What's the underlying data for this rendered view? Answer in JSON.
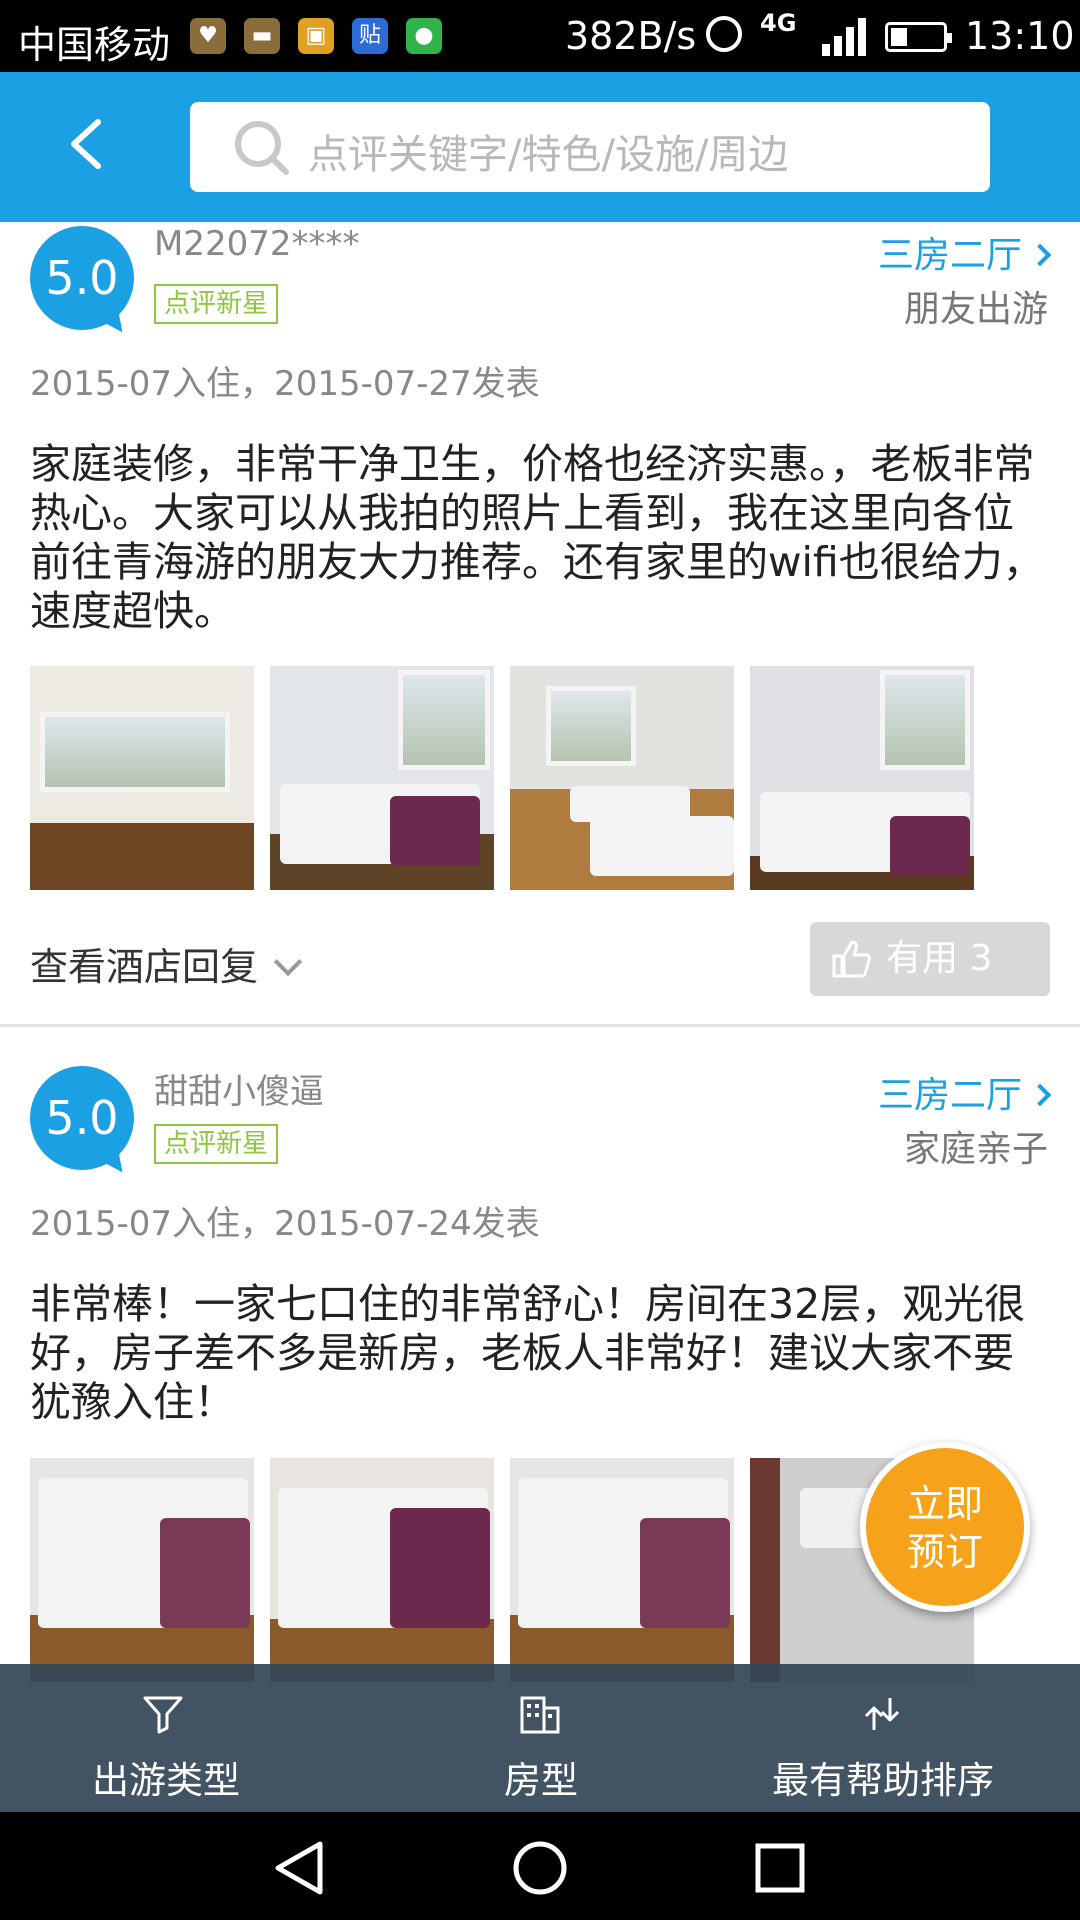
{
  "status_bar": {
    "carrier": "中国移动",
    "apps": [
      {
        "icon": "activity-app-icon",
        "color": "#8a6d3b",
        "glyph": "♥"
      },
      {
        "icon": "chat-app-icon",
        "color": "#8a6d3b",
        "glyph": "▬"
      },
      {
        "icon": "bag-app-icon",
        "color": "#e0a020",
        "glyph": "▣"
      },
      {
        "icon": "tieba-app-icon",
        "color": "#2d6bd6",
        "glyph": "贴"
      },
      {
        "icon": "wechat-app-icon",
        "color": "#2fb34a",
        "glyph": "●"
      }
    ],
    "speed": "382B/s",
    "network": "4G",
    "time": "13:10"
  },
  "header": {
    "back_icon": "chevron-left-icon",
    "search_placeholder": "点评关键字/特色/设施/周边"
  },
  "reviews": [
    {
      "score": "5.0",
      "username": "M22072****",
      "badge": "点评新星",
      "room_type": "三房二厅",
      "trip_type": "朋友出游",
      "dates": "2015-07入住，2015-07-27发表",
      "content": "家庭装修，非常干净卫生，价格也经济实惠。，老板非常热心。大家可以从我拍的照片上看到，我在这里向各位前往青海游的朋友大力推荐。还有家里的wifi也很给力，速度超快。",
      "hotel_reply": "查看酒店回复",
      "useful": "有用 3"
    },
    {
      "score": "5.0",
      "username": "甜甜小傻逼",
      "badge": "点评新星",
      "room_type": "三房二厅",
      "trip_type": "家庭亲子",
      "dates": "2015-07入住，2015-07-24发表",
      "content": "非常棒！一家七口住的非常舒心！房间在32层，观光很好，房子差不多是新房，老板人非常好！建议大家不要犹豫入住！"
    }
  ],
  "book_button": {
    "line1": "立即",
    "line2": "预订"
  },
  "filter_bar": {
    "items": [
      {
        "label": "出游类型",
        "icon": "filter-icon"
      },
      {
        "label": "房型",
        "icon": "building-icon"
      },
      {
        "label": "最有帮助排序",
        "icon": "sort-icon"
      }
    ]
  },
  "colors": {
    "accent": "#1aa0e3",
    "badge_green": "#8dc63f",
    "book_orange": "#f7a21b",
    "filter_bar": "#344658"
  }
}
